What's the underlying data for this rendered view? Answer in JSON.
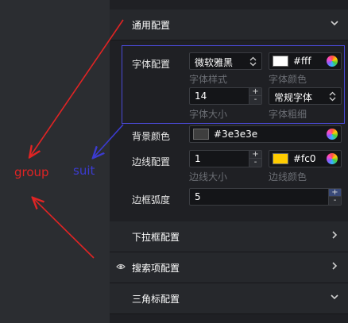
{
  "sections": {
    "general": {
      "title": "通用配置",
      "icon": "chevron-down-icon"
    },
    "dropdown": {
      "title": "下拉框配置",
      "icon": "chevron-right-icon"
    },
    "search": {
      "title": "搜索项配置",
      "icon": "chevron-right-icon",
      "leading_icon": "eye-icon"
    },
    "triangle": {
      "title": "三角标配置",
      "icon": "chevron-down-icon"
    }
  },
  "font_config": {
    "label": "字体配置",
    "family": {
      "value": "微软雅黑",
      "caption": "字体样式"
    },
    "color": {
      "value": "#fff",
      "caption": "字体颜色",
      "swatch": "#ffffff"
    },
    "size": {
      "value": "14",
      "caption": "字体大小"
    },
    "weight": {
      "value": "常规字体",
      "caption": "字体粗细"
    }
  },
  "background": {
    "label": "背景颜色",
    "value": "#3e3e3e",
    "swatch": "#3e3e3e"
  },
  "border": {
    "label": "边线配置",
    "width": {
      "value": "1",
      "caption": "边线大小"
    },
    "color": {
      "value": "#fc0",
      "caption": "边线颜色",
      "swatch": "#ffcc00"
    }
  },
  "radius": {
    "label": "边框弧度",
    "value": "5"
  },
  "annotations": {
    "group": {
      "text": "group",
      "color": "#e02424"
    },
    "suit": {
      "text": "suit",
      "color": "#3b3bd0"
    }
  },
  "spinner": {
    "up": "+",
    "down": "-"
  }
}
